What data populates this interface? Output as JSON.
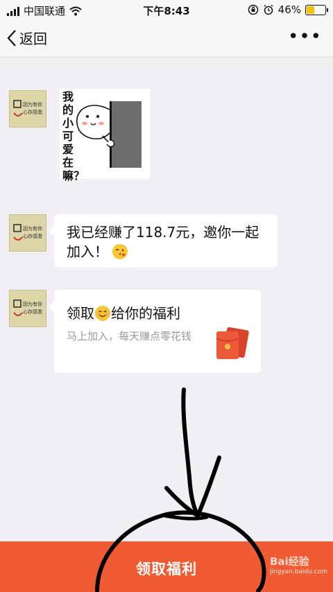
{
  "status_bar": {
    "carrier": "中国联通",
    "time": "下午8:43",
    "battery_pct": "46%",
    "battery_level": 0.46,
    "icons": [
      "signal-icon",
      "wifi-icon",
      "lock-rotation-icon",
      "alarm-icon",
      "battery-icon"
    ]
  },
  "nav": {
    "back_label": "返回",
    "more_label": "•••"
  },
  "messages": [
    {
      "type": "sticker",
      "avatar_text": [
        "因为有你",
        "心存感激"
      ],
      "sticker_text": "我的小可爱在嘛？"
    },
    {
      "type": "text",
      "avatar_text": [
        "因为有你",
        "心存感激"
      ],
      "text": "我已经赚了118.7元，邀你一起加入！",
      "emoji": "kissing-face"
    },
    {
      "type": "card",
      "avatar_text": [
        "因为有你",
        "心存感激"
      ],
      "title_before": "领取",
      "title_after": "给你的福利",
      "subtitle": "马上加入，每天赚点零花钱",
      "emoji": "smiling-face",
      "icon": "red-envelope-icon"
    }
  ],
  "bottom_button": {
    "label": "领取福利",
    "color": "#f05b33"
  },
  "watermark": {
    "text": "Bai经验",
    "url_text": "jingyan.baidu.com"
  }
}
